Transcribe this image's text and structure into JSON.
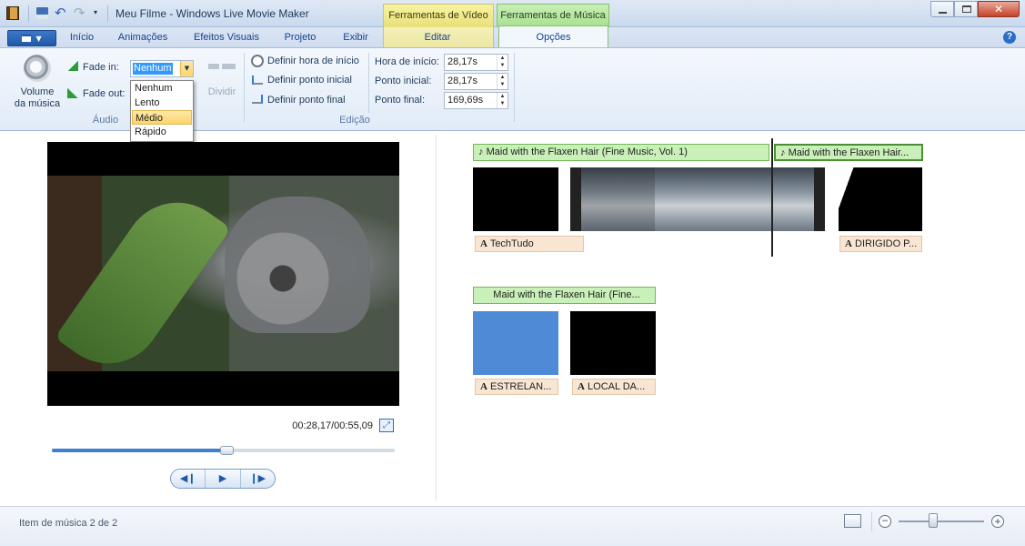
{
  "window": {
    "title": "Meu Filme - Windows Live Movie Maker",
    "context_video": "Ferramentas de Vídeo",
    "context_music": "Ferramentas de Música"
  },
  "tabs": {
    "inicio": "Início",
    "animacoes": "Animações",
    "efeitos": "Efeitos Visuais",
    "projeto": "Projeto",
    "exibir": "Exibir",
    "editar": "Editar",
    "opcoes": "Opções"
  },
  "ribbon": {
    "volume_line1": "Volume",
    "volume_line2": "da música",
    "fade_in_label": "Fade in:",
    "fade_in_value": "Nenhum",
    "fade_out_label": "Fade out:",
    "dividir": "Dividir",
    "audio_group": "Áudio",
    "definir_hora": "Definir hora de início",
    "definir_inicial": "Definir ponto inicial",
    "definir_final": "Definir ponto final",
    "hora_inicio_label": "Hora de início:",
    "hora_inicio_value": "28,17s",
    "ponto_inicial_label": "Ponto inicial:",
    "ponto_inicial_value": "28,17s",
    "ponto_final_label": "Ponto final:",
    "ponto_final_value": "169,69s",
    "edicao_group": "Edição"
  },
  "dropdown": {
    "options": [
      "Nenhum",
      "Lento",
      "Médio",
      "Rápido"
    ],
    "highlighted": "Médio"
  },
  "preview": {
    "timecode": "00:28,17/00:55,09",
    "progress_fraction": 0.506
  },
  "storyboard": {
    "music1": "Maid with the Flaxen Hair (Fine Music, Vol. 1)",
    "music2": "Maid with the Flaxen Hair...",
    "music3": "Maid with the Flaxen Hair (Fine...",
    "caption1": "TechTudo",
    "caption2": "DIRIGIDO P...",
    "caption3": "ESTRELAN...",
    "caption4": "LOCAL DA..."
  },
  "status": {
    "text": "Item de música 2 de 2",
    "zoom_fraction": 0.42
  },
  "colors": {
    "accent_blue": "#3e7fce",
    "music_green": "#c9f0b8",
    "caption_tan": "#f8e6d3",
    "clip_blue": "#4f8ad6"
  }
}
